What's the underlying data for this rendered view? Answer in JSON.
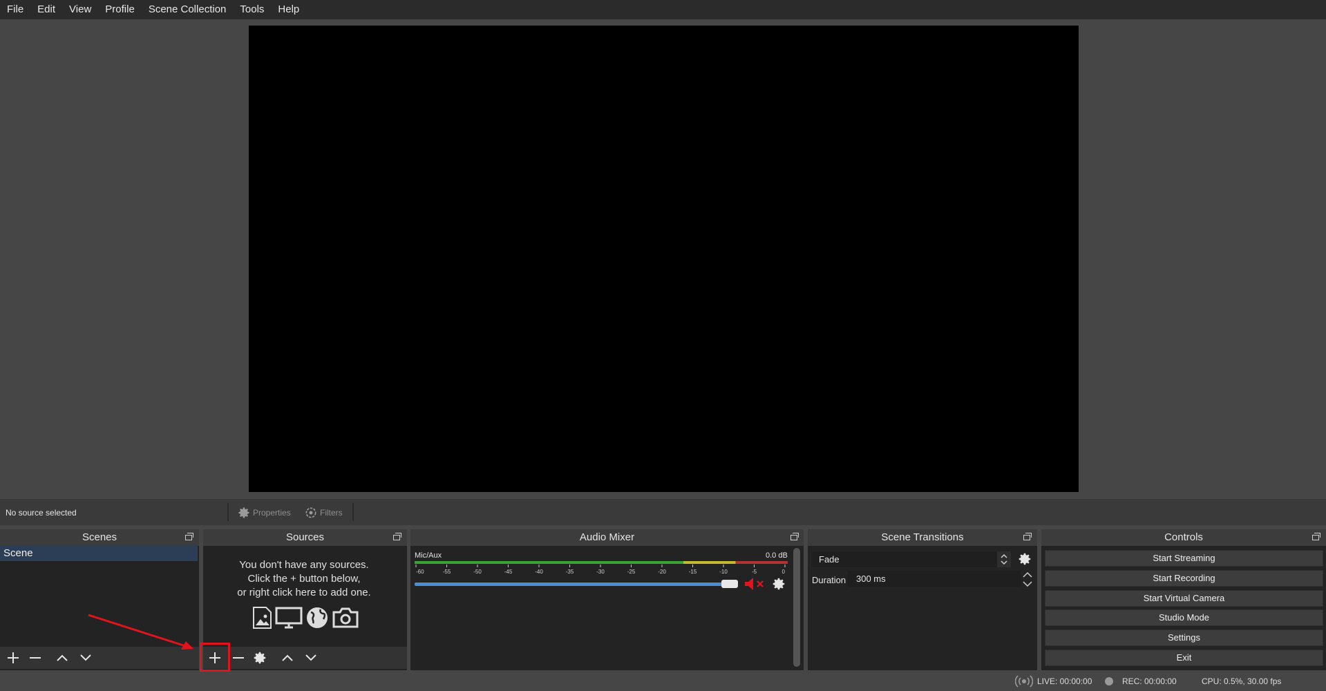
{
  "menu": [
    "File",
    "Edit",
    "View",
    "Profile",
    "Scene Collection",
    "Tools",
    "Help"
  ],
  "context": {
    "no_source": "No source selected",
    "properties": "Properties",
    "filters": "Filters"
  },
  "scenes": {
    "title": "Scenes",
    "items": [
      "Scene"
    ]
  },
  "sources": {
    "title": "Sources",
    "empty_line1": "You don't have any sources.",
    "empty_line2": "Click the + button below,",
    "empty_line3": "or right click here to add one."
  },
  "audio_mixer": {
    "title": "Audio Mixer",
    "channel": "Mic/Aux",
    "level": "0.0 dB",
    "ticks": [
      "-60",
      "-55",
      "-50",
      "-45",
      "-40",
      "-35",
      "-30",
      "-25",
      "-20",
      "-15",
      "-10",
      "-5",
      "0"
    ],
    "volume_fraction": 1.0,
    "muted": true
  },
  "transitions": {
    "title": "Scene Transitions",
    "selected": "Fade",
    "duration_label": "Duration",
    "duration_value": "300 ms"
  },
  "controls": {
    "title": "Controls",
    "start_streaming": "Start Streaming",
    "start_recording": "Start Recording",
    "start_virtual_camera": "Start Virtual Camera",
    "studio_mode": "Studio Mode",
    "settings": "Settings",
    "exit": "Exit"
  },
  "status": {
    "live": "LIVE: 00:00:00",
    "rec": "REC: 00:00:00",
    "cpu": "CPU: 0.5%, 30.00 fps"
  },
  "colors": {
    "accent_selection": "#2c3e55",
    "annotation_red": "#e0141c",
    "volume_blue": "#4a8fd6",
    "mute_red": "#e0141c"
  }
}
